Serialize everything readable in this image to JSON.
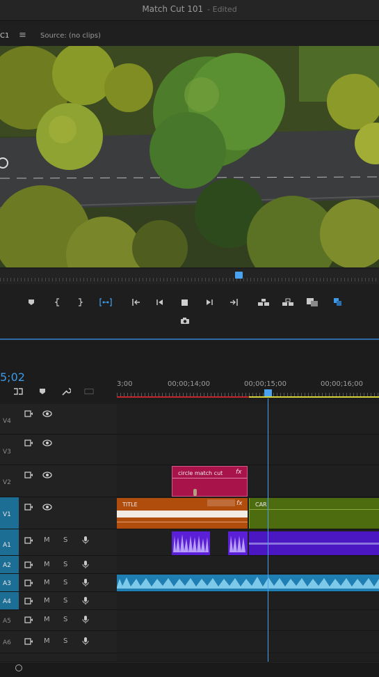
{
  "window": {
    "title": "Match Cut 101",
    "status": "- Edited"
  },
  "program_monitor": {
    "sequence_tab": "C1",
    "menu_glyph": "≡",
    "source_label": "Source: (no clips)",
    "playhead_fraction": 0.63
  },
  "transport_icons": [
    "add-marker-icon",
    "mark-in-icon",
    "mark-out-icon",
    "mark-clip-icon",
    "go-to-in-icon",
    "step-back-icon",
    "stop-icon",
    "step-forward-icon",
    "go-to-out-icon",
    "lift-icon",
    "extract-icon",
    "export-frame-icon",
    "insert-icon",
    "camera-icon"
  ],
  "timeline": {
    "timecode": "5;02",
    "ruler_labels": [
      "3;00",
      "00;00;14;00",
      "00;00;15;00",
      "00;00;16;00"
    ],
    "tracks": {
      "V4": "V4",
      "V3": "V3",
      "V2": "V2",
      "V1": "V1",
      "A1": "A1",
      "A2": "A2",
      "A3": "A3",
      "A4": "A4",
      "A5": "A5",
      "A6": "A6"
    },
    "mute_label": "M",
    "solo_label": "S",
    "clips": {
      "v2_clip": "circle match cut",
      "v1_title": "TITLE",
      "v1_car": "CAR",
      "fx": "fx"
    }
  },
  "colors": {
    "accent": "#3d9ae6",
    "v2_clip": "#b0154a",
    "title_clip": "#b8520d",
    "car_clip": "#4d6b0f",
    "audio_purple": "#5a1fd6",
    "audio_cyan": "#39a6d6",
    "selected_track": "#1d6e95"
  }
}
